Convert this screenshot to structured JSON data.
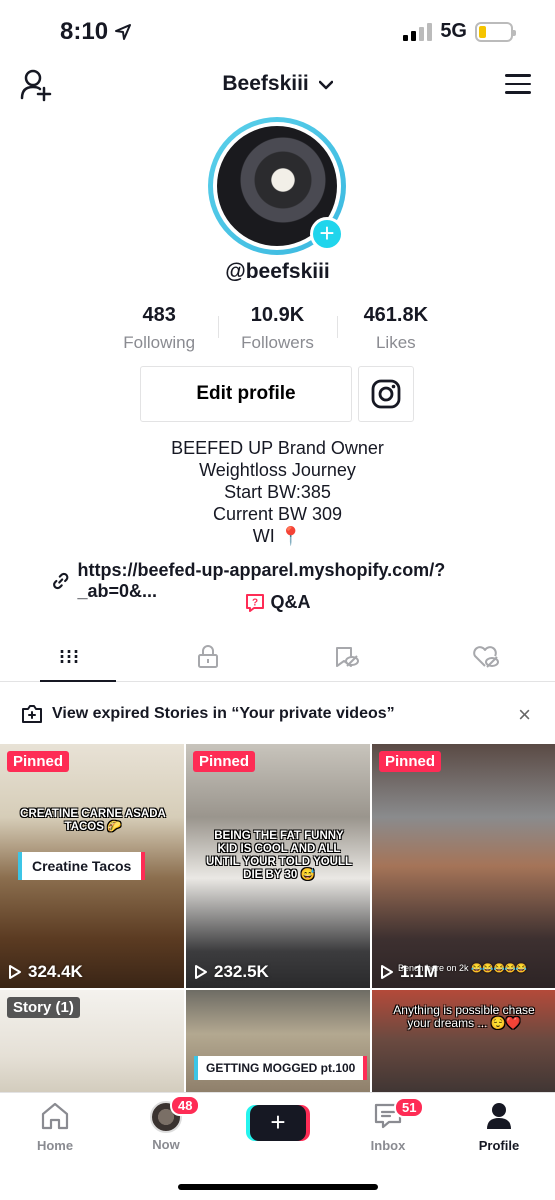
{
  "status_bar": {
    "time": "8:10",
    "network": "5G",
    "battery_level": 0.22
  },
  "header": {
    "username_title": "Beefskiii"
  },
  "profile": {
    "handle": "@beefskiii",
    "stats": [
      {
        "value": "483",
        "label": "Following"
      },
      {
        "value": "10.9K",
        "label": "Followers"
      },
      {
        "value": "461.8K",
        "label": "Likes"
      }
    ],
    "edit_label": "Edit profile",
    "bio_lines": [
      "BEEFED UP Brand Owner",
      "Weightloss Journey",
      "Start BW:385",
      "Current BW 309",
      "WI 📍"
    ],
    "link": "https://beefed-up-apparel.myshopify.com/?_ab=0&...",
    "qa_label": "Q&A"
  },
  "stories_banner": {
    "text": "View expired Stories in “Your private videos”",
    "close": "×"
  },
  "videos": [
    {
      "badge": "Pinned",
      "views": "324.4K",
      "caption": "CREATINE CARNE ASADA TACOS 🌮",
      "label": "Creatine Tacos"
    },
    {
      "badge": "Pinned",
      "views": "232.5K",
      "caption": "BEING THE FAT FUNNY KID IS COOL AND ALL UNTIL YOUR TOLD YOULL DIE BY 30 😅"
    },
    {
      "badge": "Pinned",
      "views": "1.1M",
      "caption": "Bench here on 2k 😂😂😂😂😂"
    },
    {
      "badge": "Story (1)"
    },
    {
      "label": "GETTING MOGGED pt.100"
    },
    {
      "caption": "Anything is possible chase your dreams ... 😌❤️"
    }
  ],
  "bottom_nav": {
    "home": "Home",
    "now": "Now",
    "now_count": "48",
    "inbox": "Inbox",
    "inbox_count": "51",
    "profile": "Profile",
    "create": "+"
  }
}
